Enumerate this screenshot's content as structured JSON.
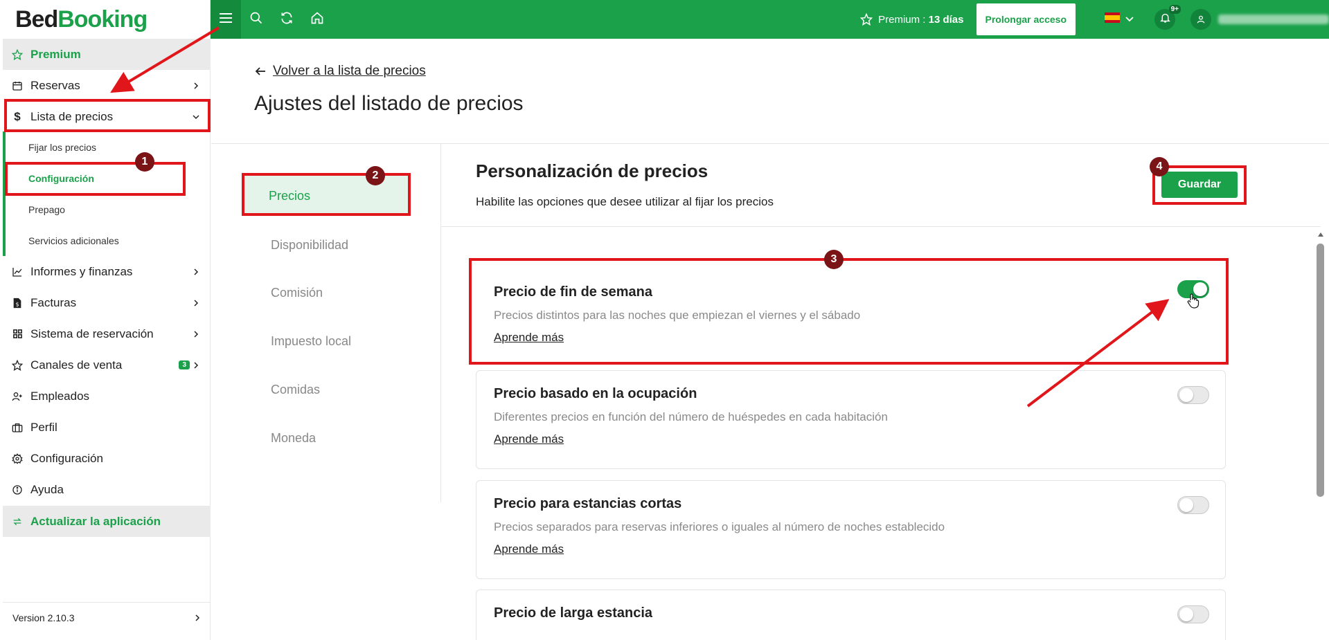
{
  "brand": {
    "part1": "Bed",
    "part2": "Booking"
  },
  "sidebar": {
    "premium": "Premium",
    "reservas": "Reservas",
    "lista_precios": "Lista de precios",
    "sub": {
      "fijar": "Fijar los precios",
      "configuracion": "Configuración",
      "prepago": "Prepago",
      "servicios": "Servicios adicionales"
    },
    "informes": "Informes y finanzas",
    "facturas": "Facturas",
    "sistema": "Sistema de reservación",
    "canales": "Canales de venta",
    "canales_badge": "3",
    "empleados": "Empleados",
    "perfil": "Perfil",
    "configuracion": "Configuración",
    "ayuda": "Ayuda",
    "actualizar": "Actualizar la aplicación",
    "version": "Version 2.10.3"
  },
  "topbar": {
    "premium_label": "Premium :",
    "premium_days": "13 días",
    "prolongar": "Prolongar acceso",
    "notifications": "9+"
  },
  "main": {
    "back": "Volver a la lista de precios",
    "title": "Ajustes del listado de precios",
    "tabs": [
      "Precios",
      "Disponibilidad",
      "Comisión",
      "Impuesto local",
      "Comidas",
      "Moneda"
    ],
    "panel_title": "Personalización de precios",
    "panel_sub": "Habilite las opciones que desee utilizar al fijar los precios",
    "save": "Guardar",
    "cards": [
      {
        "title": "Precio de fin de semana",
        "desc": "Precios distintos para las noches que empiezan el viernes y el sábado",
        "link": "Aprende más",
        "enabled": true
      },
      {
        "title": "Precio basado en la ocupación",
        "desc": "Diferentes precios en función del número de huéspedes en cada habitación",
        "link": "Aprende más",
        "enabled": false
      },
      {
        "title": "Precio para estancias cortas",
        "desc": "Precios separados para reservas inferiores o iguales al número de noches establecido",
        "link": "Aprende más",
        "enabled": false
      },
      {
        "title": "Precio de larga estancia",
        "enabled": false
      }
    ]
  },
  "annotations": [
    "1",
    "2",
    "3",
    "4"
  ],
  "colors": {
    "brand_green": "#1aa14a",
    "annotation_red": "#e0161a",
    "badge_dark": "#7a1416"
  }
}
